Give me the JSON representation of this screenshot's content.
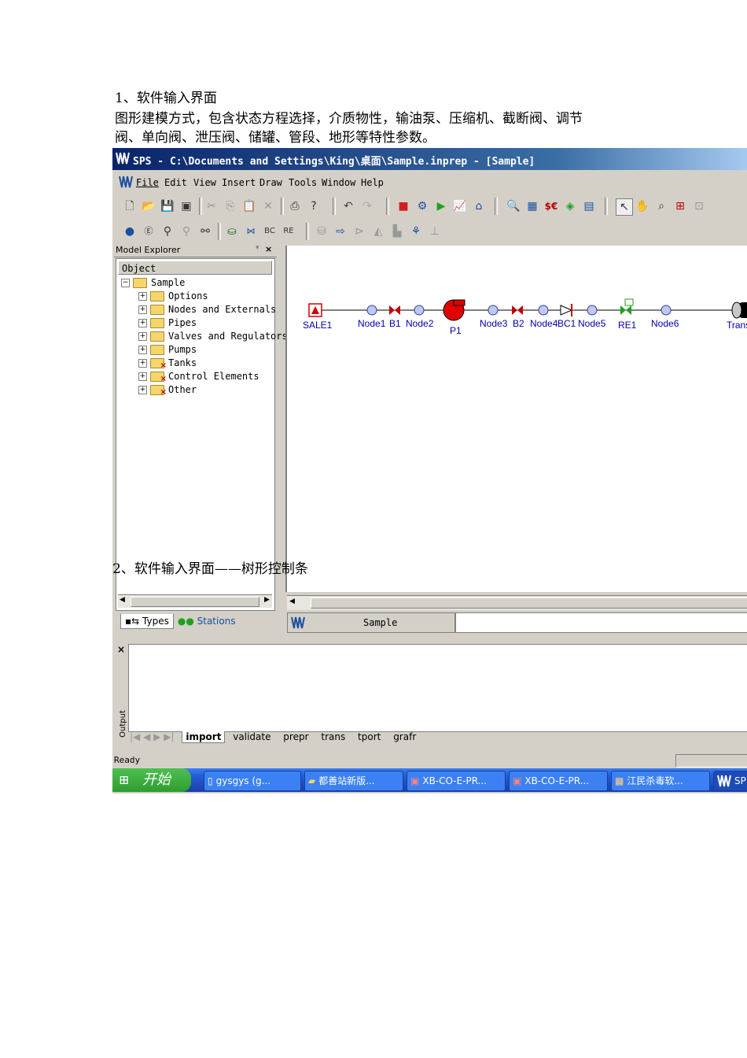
{
  "doc": {
    "heading1": "1、软件输入界面",
    "para1_line1": "图形建模方式，包含状态方程选择，介质物性，输油泵、压缩机、截断阀、调节",
    "para1_line2": "阀、单向阀、泄压阀、储罐、管段、地形等特性参数。",
    "heading2": "2、软件输入界面——树形控制条"
  },
  "window": {
    "title": "SPS - C:\\Documents and Settings\\King\\桌面\\Sample.inprep - [Sample]",
    "menu": [
      "File",
      "Edit",
      "View",
      "Insert",
      "Draw",
      "Tools",
      "Window",
      "Help"
    ]
  },
  "explorer": {
    "title": "Model Explorer",
    "column_header": "Object",
    "root": "Sample",
    "items": [
      "Options",
      "Nodes and Externals",
      "Pipes",
      "Valves and Regulators",
      "Pumps",
      "Tanks",
      "Control Elements",
      "Other"
    ],
    "tabs": [
      "Types",
      "Stations"
    ]
  },
  "diagram": {
    "labels": [
      "SALE1",
      "Node1",
      "B1",
      "Node2",
      "P1",
      "Node3",
      "B2",
      "Node4",
      "BC1",
      "Node5",
      "RE1",
      "Node6",
      "Trans"
    ],
    "doc_tab": "Sample"
  },
  "output": {
    "side_label": "Output",
    "tabs": [
      "import",
      "validate",
      "prepr",
      "trans",
      "tport",
      "grafr"
    ]
  },
  "status": {
    "text": "Ready"
  },
  "taskbar": {
    "start": "开始",
    "tasks": [
      "gysgys (g...",
      "都善站新版...",
      "XB-CO-E-PR...",
      "XB-CO-E-PR...",
      "江民杀毒软...",
      "SP"
    ]
  },
  "colors": {
    "title_bar": "#0a246a",
    "node_label": "#0000aa",
    "pump": "#e00000",
    "valve": "#d01010",
    "regulator": "#20a020",
    "taskbar": "#245edb"
  }
}
